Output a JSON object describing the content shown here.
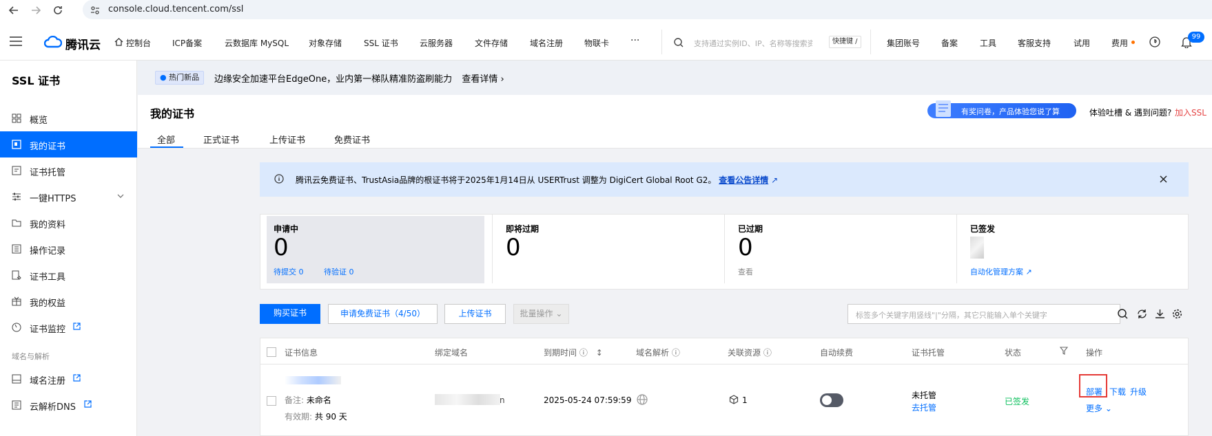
{
  "browser": {
    "url": "console.cloud.tencent.com/ssl"
  },
  "topnav": {
    "logo": "腾讯云",
    "items": [
      "控制台",
      "ICP备案",
      "云数据库 MySQL",
      "对象存储",
      "SSL 证书",
      "云服务器",
      "文件存储",
      "域名注册",
      "物联卡",
      "···"
    ],
    "search_placeholder": "支持通过实例ID、IP、名称等搜索资源",
    "search_shortcut": "快捷键 /",
    "right_items": [
      "集团账号",
      "备案",
      "工具",
      "客服支持",
      "试用",
      "费用"
    ],
    "notification_count": "99"
  },
  "sidebar": {
    "title": "SSL 证书",
    "items": [
      {
        "label": "概览",
        "icon": "grid-icon"
      },
      {
        "label": "我的证书",
        "icon": "certificate-icon"
      },
      {
        "label": "证书托管",
        "icon": "hosting-icon"
      },
      {
        "label": "一键HTTPS",
        "icon": "sliders-icon"
      },
      {
        "label": "我的资料",
        "icon": "folder-icon"
      },
      {
        "label": "操作记录",
        "icon": "list-icon"
      },
      {
        "label": "证书工具",
        "icon": "tool-icon"
      },
      {
        "label": "我的权益",
        "icon": "gift-icon"
      },
      {
        "label": "证书监控",
        "icon": "monitor-icon"
      }
    ],
    "group_label": "域名与解析",
    "group_items": [
      {
        "label": "域名注册",
        "icon": "domain-icon"
      },
      {
        "label": "云解析DNS",
        "icon": "dns-icon"
      }
    ]
  },
  "promo": {
    "tag": "热门新品",
    "text": "边缘安全加速平台EdgeOne，业内第一梯队精准防盗刷能力",
    "link": "查看详情"
  },
  "header": {
    "title": "我的证书",
    "tabs": [
      "全部",
      "正式证书",
      "上传证书",
      "免费证书"
    ],
    "survey": "有奖问卷，产品体验您说了算",
    "feedback": "体验吐槽 & 遇到问题?",
    "feedback_link": "加入SSL"
  },
  "notice": {
    "text": "腾讯云免费证书、TrustAsia品牌的根证书将于2025年1月14日从 USERTrust 调整为 DigiCert Global Root G2。",
    "link": "查看公告详情"
  },
  "stats": [
    {
      "label": "申请中",
      "value": "0",
      "sub1": "待提交 0",
      "sub2": "待验证 0"
    },
    {
      "label": "即将过期",
      "value": "0"
    },
    {
      "label": "已过期",
      "value": "0",
      "sub1": "查看"
    },
    {
      "label": "已签发",
      "sub1": "自动化管理方案"
    }
  ],
  "actions": {
    "buy": "购买证书",
    "apply_free": "申请免费证书（4/50）",
    "upload": "上传证书",
    "batch": "批量操作",
    "tag_search_placeholder": "标签多个关键字用竖线\"|\"分隔，其它只能输入单个关键字"
  },
  "table": {
    "headers": [
      "证书信息",
      "绑定域名",
      "到期时间",
      "域名解析",
      "关联资源",
      "自动续费",
      "证书托管",
      "状态",
      "操作"
    ],
    "row": {
      "remark_label": "备注:",
      "remark_value": "未命名",
      "validity_label": "有效期:",
      "validity_value": "共 90 天",
      "domain_suffix": "n",
      "expires": "2025-05-24 07:59:59",
      "resources": "1",
      "hosting": "未托管",
      "hosting_link": "去托管",
      "status": "已签发",
      "ops": [
        "部署",
        "下载",
        "升级"
      ],
      "more": "更多"
    }
  },
  "colors": {
    "primary": "#006eff",
    "success": "#0abf5b",
    "danger": "#e54545",
    "highlight": "#e53935"
  }
}
